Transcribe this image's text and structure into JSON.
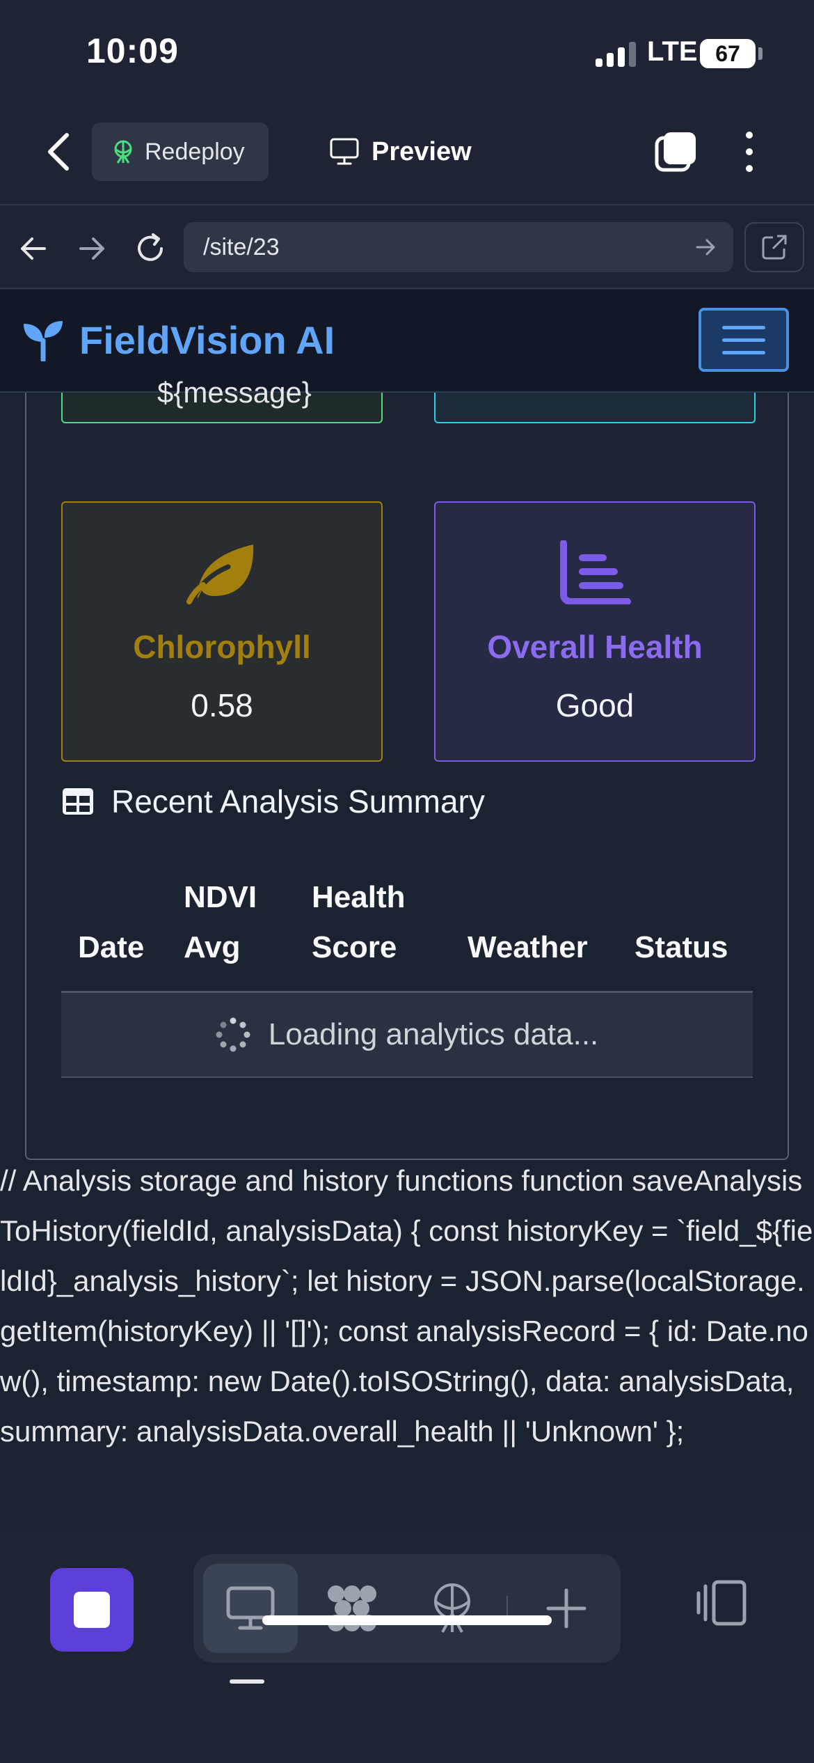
{
  "status_bar": {
    "time": "10:09",
    "network": "LTE",
    "battery": "67"
  },
  "app_bar": {
    "redeploy_label": "Redeploy",
    "preview_label": "Preview"
  },
  "browser": {
    "url": "/site/23"
  },
  "site": {
    "brand_name": "FieldVision AI",
    "message_placeholder": "${message}",
    "metrics": [
      {
        "label": "Chlorophyll",
        "value": "0.58",
        "icon": "leaf-icon",
        "color": "#a3800d"
      },
      {
        "label": "Overall Health",
        "value": "Good",
        "icon": "bar-chart-icon",
        "color": "#7c5ce6"
      }
    ],
    "summary_title": "Recent Analysis Summary",
    "table": {
      "headers": [
        "Date",
        "NDVI Avg",
        "Health Score",
        "Weather",
        "Status"
      ],
      "loading_text": "Loading analytics data..."
    },
    "code_text": "// Analysis storage and history functions function saveAnalysisToHistory(fieldId, analysisData) { const historyKey = `field_${fieldId}_analysis_history`; let history = JSON.parse(localStorage.getItem(historyKey) || '[]'); const analysisRecord = { id: Date.now(), timestamp: new Date().toISOString(), data: analysisData, summary: analysisData.overall_health || 'Unknown' };"
  },
  "colors": {
    "accent": "#60a5fa",
    "primary_action": "#5b3fd6",
    "background": "#1e2433"
  }
}
